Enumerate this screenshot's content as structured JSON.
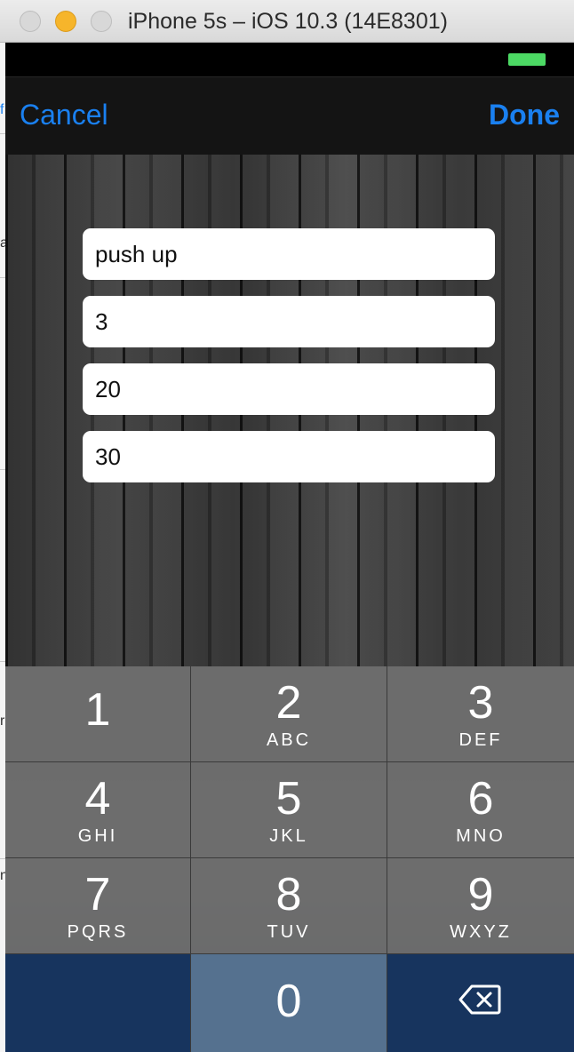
{
  "window": {
    "title": "iPhone 5s – iOS 10.3 (14E8301)"
  },
  "navbar": {
    "cancel_label": "Cancel",
    "done_label": "Done"
  },
  "form": {
    "fields": [
      {
        "value": "push up"
      },
      {
        "value": "3"
      },
      {
        "value": "20"
      },
      {
        "value": "30"
      }
    ]
  },
  "keypad": {
    "keys": [
      {
        "num": "1",
        "letters": ""
      },
      {
        "num": "2",
        "letters": "ABC"
      },
      {
        "num": "3",
        "letters": "DEF"
      },
      {
        "num": "4",
        "letters": "GHI"
      },
      {
        "num": "5",
        "letters": "JKL"
      },
      {
        "num": "6",
        "letters": "MNO"
      },
      {
        "num": "7",
        "letters": "PQRS"
      },
      {
        "num": "8",
        "letters": "TUV"
      },
      {
        "num": "9",
        "letters": "WXYZ"
      },
      {
        "num": "0",
        "letters": ""
      }
    ],
    "delete_icon": "backspace-icon"
  },
  "colors": {
    "accent": "#1a80f0",
    "battery": "#4cd964"
  }
}
